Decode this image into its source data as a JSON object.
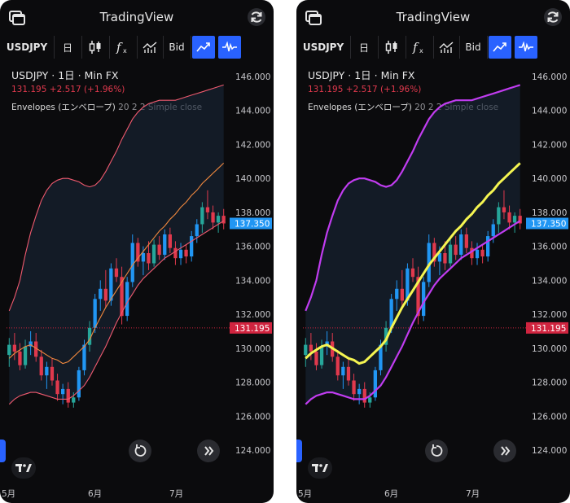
{
  "app_title": "TradingView",
  "toolbar": {
    "symbol": "USDJPY",
    "interval": "日",
    "bid_label": "Bid"
  },
  "header": {
    "symbol_line": "USDJPY · 1日 · Min FX",
    "last_price": "131.195",
    "change": "+2.517 (+1.96%)",
    "indicator_name": "Envelopes (エンベロープ)",
    "indicator_params": "20 2 2 Simple close"
  },
  "price_axis": {
    "ticks": [
      "146.000",
      "144.000",
      "142.000",
      "140.000",
      "138.000",
      "136.000",
      "134.000",
      "132.000",
      "130.000",
      "128.000",
      "126.000",
      "124.000"
    ],
    "tick_values": [
      146,
      144,
      142,
      140,
      138,
      136,
      134,
      132,
      130,
      128,
      126,
      124
    ],
    "current_label": "137.350",
    "current_value": 137.35,
    "current_color": "#2196f3",
    "prev_close_label": "131.195",
    "prev_close_value": 131.195,
    "prev_close_color": "#d0243f"
  },
  "time_axis": [
    "5月",
    "6月",
    "7月"
  ],
  "colors": {
    "up": "#26a69a",
    "up_alt": "#2196f3",
    "down": "#e0394d",
    "left_upper": "#f05a6f",
    "left_lower": "#f05a6f",
    "left_basis": "#f0883e",
    "right_upper": "#c13cf0",
    "right_lower": "#c13cf0",
    "right_basis": "#f5f551",
    "band_fill": "#1b2a3d"
  },
  "icons": {
    "windows": "windows-icon",
    "refresh": "refresh-icon",
    "candles": "candlestick-icon",
    "indicators": "fx-indicator-icon",
    "compare": "bar-chart-icon",
    "trend": "trend-line-icon",
    "waveform": "waveform-icon",
    "reset": "reset-icon",
    "forward": "double-chevron-icon",
    "logo": "tradingview-logo-icon"
  },
  "chart_data": {
    "type": "candlestick",
    "ylim": [
      123,
      147
    ],
    "candles": [
      {
        "o": 129.6,
        "h": 130.6,
        "l": 128.9,
        "c": 130.2
      },
      {
        "o": 130.2,
        "h": 130.9,
        "l": 129.3,
        "c": 129.8
      },
      {
        "o": 129.8,
        "h": 130.3,
        "l": 128.7,
        "c": 129.0
      },
      {
        "o": 129.0,
        "h": 130.5,
        "l": 128.8,
        "c": 130.1
      },
      {
        "o": 130.1,
        "h": 131.0,
        "l": 129.6,
        "c": 130.4
      },
      {
        "o": 130.4,
        "h": 130.9,
        "l": 129.2,
        "c": 129.5
      },
      {
        "o": 129.5,
        "h": 129.9,
        "l": 128.1,
        "c": 128.4
      },
      {
        "o": 128.4,
        "h": 129.2,
        "l": 127.6,
        "c": 128.9
      },
      {
        "o": 128.9,
        "h": 129.4,
        "l": 127.8,
        "c": 128.1
      },
      {
        "o": 128.1,
        "h": 128.5,
        "l": 126.9,
        "c": 127.3
      },
      {
        "o": 127.3,
        "h": 127.9,
        "l": 126.7,
        "c": 127.6
      },
      {
        "o": 127.6,
        "h": 128.0,
        "l": 126.5,
        "c": 126.8
      },
      {
        "o": 126.8,
        "h": 127.4,
        "l": 126.5,
        "c": 127.1
      },
      {
        "o": 127.1,
        "h": 128.9,
        "l": 126.9,
        "c": 128.7
      },
      {
        "o": 128.7,
        "h": 130.5,
        "l": 128.4,
        "c": 130.2
      },
      {
        "o": 130.2,
        "h": 131.6,
        "l": 129.8,
        "c": 131.2
      },
      {
        "o": 131.2,
        "h": 133.2,
        "l": 130.9,
        "c": 132.9
      },
      {
        "o": 132.9,
        "h": 134.0,
        "l": 132.2,
        "c": 133.5
      },
      {
        "o": 133.5,
        "h": 134.6,
        "l": 132.4,
        "c": 132.8
      },
      {
        "o": 132.8,
        "h": 135.0,
        "l": 132.5,
        "c": 134.7
      },
      {
        "o": 134.7,
        "h": 135.3,
        "l": 133.9,
        "c": 134.2
      },
      {
        "o": 134.2,
        "h": 134.8,
        "l": 131.4,
        "c": 131.9
      },
      {
        "o": 131.9,
        "h": 134.2,
        "l": 131.6,
        "c": 133.9
      },
      {
        "o": 133.9,
        "h": 136.7,
        "l": 133.6,
        "c": 136.2
      },
      {
        "o": 136.2,
        "h": 136.5,
        "l": 134.8,
        "c": 135.1
      },
      {
        "o": 135.1,
        "h": 136.0,
        "l": 134.3,
        "c": 135.6
      },
      {
        "o": 135.6,
        "h": 136.3,
        "l": 134.6,
        "c": 135.0
      },
      {
        "o": 135.0,
        "h": 136.4,
        "l": 134.8,
        "c": 136.1
      },
      {
        "o": 136.1,
        "h": 136.6,
        "l": 135.2,
        "c": 135.5
      },
      {
        "o": 135.5,
        "h": 137.0,
        "l": 135.2,
        "c": 136.7
      },
      {
        "o": 136.7,
        "h": 137.1,
        "l": 135.6,
        "c": 135.9
      },
      {
        "o": 135.9,
        "h": 136.3,
        "l": 134.9,
        "c": 135.3
      },
      {
        "o": 135.3,
        "h": 136.2,
        "l": 134.9,
        "c": 135.8
      },
      {
        "o": 135.8,
        "h": 136.1,
        "l": 135.0,
        "c": 135.4
      },
      {
        "o": 135.4,
        "h": 136.9,
        "l": 135.1,
        "c": 136.6
      },
      {
        "o": 136.6,
        "h": 137.6,
        "l": 136.2,
        "c": 137.3
      },
      {
        "o": 137.3,
        "h": 138.6,
        "l": 136.8,
        "c": 138.3
      },
      {
        "o": 138.3,
        "h": 139.3,
        "l": 137.6,
        "c": 138.0
      },
      {
        "o": 138.0,
        "h": 138.4,
        "l": 137.0,
        "c": 137.4
      },
      {
        "o": 137.4,
        "h": 138.0,
        "l": 136.8,
        "c": 137.8
      },
      {
        "o": 137.8,
        "h": 138.2,
        "l": 137.0,
        "c": 137.35
      }
    ],
    "envelope_basis": [
      129.4,
      129.7,
      129.9,
      130.1,
      130.2,
      130.0,
      129.8,
      129.6,
      129.4,
      129.3,
      129.1,
      129.2,
      129.5,
      129.8,
      130.1,
      130.5,
      131.2,
      131.8,
      132.4,
      132.9,
      133.4,
      133.9,
      134.4,
      134.9,
      135.3,
      135.7,
      136.1,
      136.5,
      136.9,
      137.2,
      137.6,
      137.9,
      138.3,
      138.6,
      139.0,
      139.3,
      139.7,
      140.0,
      140.3,
      140.6,
      140.9
    ],
    "envelope_upper": [
      132.2,
      133.0,
      134.0,
      135.5,
      136.8,
      137.8,
      138.7,
      139.3,
      139.7,
      139.9,
      140.0,
      140.0,
      139.9,
      139.8,
      139.6,
      139.5,
      139.6,
      139.9,
      140.4,
      141.0,
      141.6,
      142.3,
      142.9,
      143.5,
      143.9,
      144.2,
      144.4,
      144.5,
      144.6,
      144.6,
      144.6,
      144.6,
      144.7,
      144.8,
      144.9,
      145.0,
      145.1,
      145.2,
      145.3,
      145.4,
      145.5
    ],
    "envelope_lower": [
      126.7,
      127.0,
      127.2,
      127.3,
      127.4,
      127.4,
      127.3,
      127.2,
      127.1,
      127.0,
      127.0,
      127.0,
      127.2,
      127.5,
      127.8,
      128.3,
      128.9,
      129.5,
      130.1,
      130.8,
      131.5,
      132.1,
      132.7,
      133.2,
      133.7,
      134.1,
      134.4,
      134.7,
      135.0,
      135.3,
      135.5,
      135.7,
      135.9,
      136.1,
      136.3,
      136.5,
      136.7,
      136.9,
      137.1,
      137.3,
      137.5
    ]
  }
}
